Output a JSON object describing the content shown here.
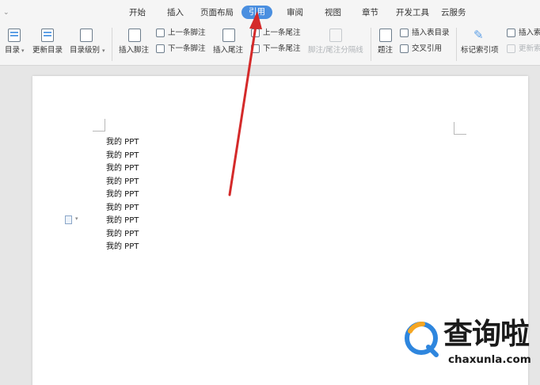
{
  "tabs": [
    {
      "label": "开始",
      "active": false
    },
    {
      "label": "插入",
      "active": false
    },
    {
      "label": "页面布局",
      "active": false
    },
    {
      "label": "引用",
      "active": true
    },
    {
      "label": "审阅",
      "active": false
    },
    {
      "label": "视图",
      "active": false
    },
    {
      "label": "章节",
      "active": false
    },
    {
      "label": "开发工具",
      "active": false
    },
    {
      "label": "云服务",
      "active": false
    }
  ],
  "toolbar": {
    "toc": "目录",
    "update_toc": "更新目录",
    "toc_level": "目录级别",
    "insert_footnote": "插入脚注",
    "prev_footnote": "上一条脚注",
    "next_footnote": "下一条脚注",
    "insert_endnote": "插入尾注",
    "prev_endnote": "上一条尾注",
    "next_endnote": "下一条尾注",
    "footnote_separator": "脚注/尾注分隔线",
    "caption": "题注",
    "insert_table_of_figures": "插入表目录",
    "cross_reference": "交叉引用",
    "mark_index_entry": "标记索引项",
    "insert_index": "插入索",
    "update_index": "更新索"
  },
  "document": {
    "lines": [
      "我的 PPT",
      "我的 PPT",
      "我的 PPT",
      "我的 PPT",
      "我的 PPT",
      "我的 PPT",
      "我的 PPT",
      "我的 PPT",
      "我的 PPT"
    ]
  },
  "watermark": {
    "brand_cn": "查询啦",
    "brand_en": "chaxunla.com"
  },
  "colors": {
    "active_tab": "#4a8fe0",
    "annotation_arrow": "#d42a2a",
    "logo_blue": "#2e86de",
    "logo_orange": "#f5a623"
  },
  "icons": {
    "collapse": "double-chevron-down-icon",
    "paragraph": "document-icon"
  }
}
